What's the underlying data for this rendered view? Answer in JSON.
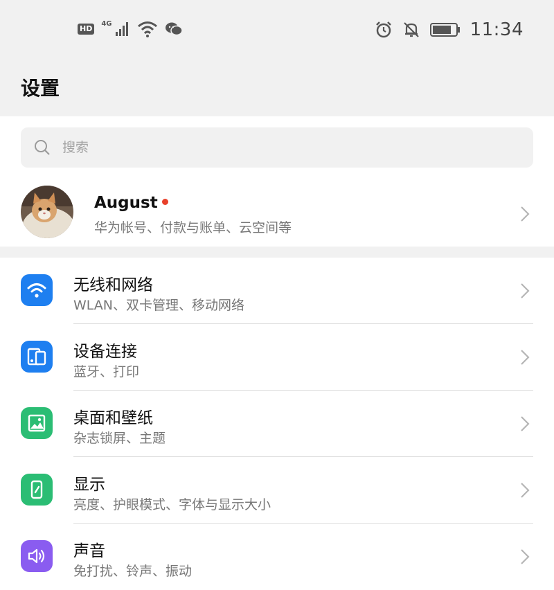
{
  "status_bar": {
    "hd": "HD",
    "network": "4G",
    "time": "11:34",
    "icons": [
      "signal-icon",
      "wifi-icon",
      "wechat-icon",
      "alarm-icon",
      "mute-icon",
      "battery-icon"
    ]
  },
  "header": {
    "title": "设置"
  },
  "search": {
    "placeholder": "搜索"
  },
  "account": {
    "name": "August",
    "subtitle": "华为帐号、付款与账单、云空间等"
  },
  "settings": [
    {
      "title": "无线和网络",
      "subtitle": "WLAN、双卡管理、移动网络",
      "icon": "wifi-icon",
      "color": "#1e7ff0"
    },
    {
      "title": "设备连接",
      "subtitle": "蓝牙、打印",
      "icon": "device-connect-icon",
      "color": "#1e7ff0"
    },
    {
      "title": "桌面和壁纸",
      "subtitle": "杂志锁屏、主题",
      "icon": "wallpaper-icon",
      "color": "#2bbd74"
    },
    {
      "title": "显示",
      "subtitle": "亮度、护眼模式、字体与显示大小",
      "icon": "display-icon",
      "color": "#2bbd74"
    },
    {
      "title": "声音",
      "subtitle": "免打扰、铃声、振动",
      "icon": "sound-icon",
      "color": "#8a5cf0"
    }
  ]
}
